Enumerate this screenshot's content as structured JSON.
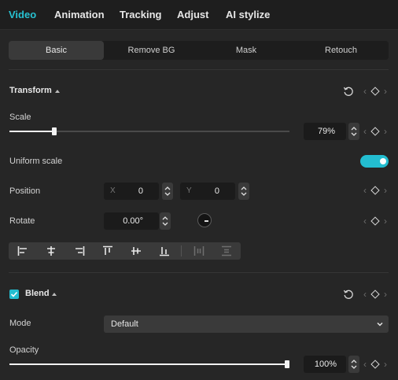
{
  "top_tabs": [
    {
      "label": "Video",
      "active": true
    },
    {
      "label": "Animation",
      "active": false
    },
    {
      "label": "Tracking",
      "active": false
    },
    {
      "label": "Adjust",
      "active": false
    },
    {
      "label": "AI stylize",
      "active": false
    }
  ],
  "sub_tabs": [
    {
      "label": "Basic",
      "active": true
    },
    {
      "label": "Remove BG",
      "active": false
    },
    {
      "label": "Mask",
      "active": false
    },
    {
      "label": "Retouch",
      "active": false
    }
  ],
  "transform": {
    "title": "Transform",
    "scale": {
      "label": "Scale",
      "value": "79%",
      "fraction": 0.16
    },
    "uniform_scale": {
      "label": "Uniform scale",
      "on": true
    },
    "position": {
      "label": "Position",
      "x_axis": "X",
      "x_value": "0",
      "y_axis": "Y",
      "y_value": "0"
    },
    "rotate": {
      "label": "Rotate",
      "value": "0.00°"
    }
  },
  "blend": {
    "title": "Blend",
    "enabled": true,
    "mode": {
      "label": "Mode",
      "value": "Default"
    },
    "opacity": {
      "label": "Opacity",
      "value": "100%",
      "fraction": 1.0
    }
  },
  "colors": {
    "accent": "#27c2d2",
    "panel": "#262626"
  },
  "icons": [
    "reset-icon",
    "keyframe-icon",
    "chevron-left-icon",
    "chevron-right-icon",
    "align-left-icon",
    "align-center-h-icon",
    "align-right-icon",
    "align-top-icon",
    "align-center-v-icon",
    "align-bottom-icon",
    "distribute-h-icon",
    "distribute-v-icon",
    "chevron-down-icon",
    "check-icon"
  ]
}
